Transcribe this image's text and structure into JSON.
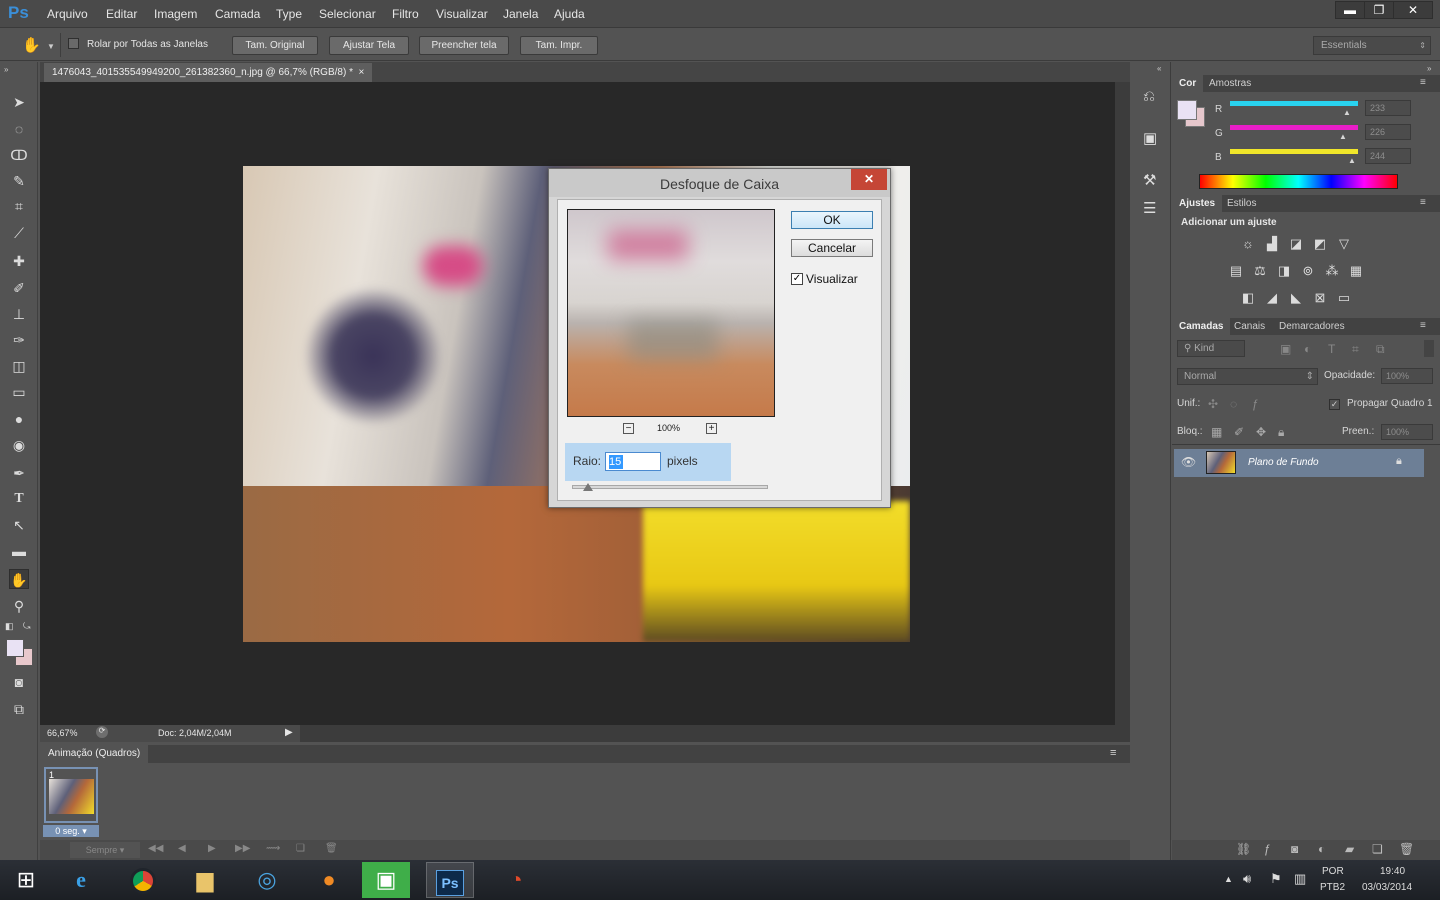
{
  "app": {
    "logo": "Ps"
  },
  "menu": [
    "Arquivo",
    "Editar",
    "Imagem",
    "Camada",
    "Type",
    "Selecionar",
    "Filtro",
    "Visualizar",
    "Janela",
    "Ajuda"
  ],
  "window_controls": {
    "minimize": "▬",
    "restore": "❐",
    "close": "✕"
  },
  "options": {
    "checkbox_label": "Rolar por Todas as Janelas",
    "buttons": [
      "Tam. Original",
      "Ajustar Tela",
      "Preencher tela",
      "Tam. Impr."
    ],
    "workspace": "Essentials"
  },
  "document": {
    "tab_title": "1476043_401535549949200_261382360_n.jpg @ 66,7% (RGB/8) *",
    "tab_close": "×"
  },
  "status": {
    "zoom": "66,67%",
    "doc": "Doc: 2,04M/2,04M"
  },
  "dialog": {
    "title": "Desfoque de Caixa",
    "close": "✕",
    "ok": "OK",
    "cancel": "Cancelar",
    "preview_label": "Visualizar",
    "preview_checked": true,
    "zoom": "100%",
    "zoom_out": "−",
    "zoom_in": "+",
    "radius_label": "Raio:",
    "radius_value": "15",
    "radius_unit": "pixels"
  },
  "color_panel": {
    "tabs": [
      "Cor",
      "Amostras"
    ],
    "rows": [
      {
        "label": "R",
        "value": "233",
        "color": "#29d3f0"
      },
      {
        "label": "G",
        "value": "226",
        "color": "#e81ec8"
      },
      {
        "label": "B",
        "value": "244",
        "color": "#f0e62a"
      }
    ],
    "foreground": "#e9e2f4"
  },
  "adjust_panel": {
    "tabs": [
      "Ajustes",
      "Estilos"
    ],
    "heading": "Adicionar um ajuste"
  },
  "layers_panel": {
    "tabs": [
      "Camadas",
      "Canais",
      "Demarcadores"
    ],
    "kind": "Kind",
    "blend": "Normal",
    "opacity_label": "Opacidade:",
    "opacity": "100%",
    "unify_label": "Unif.:",
    "propagate": "Propagar Quadro 1",
    "lock_label": "Bloq.:",
    "fill_label": "Preen.:",
    "fill": "100%",
    "layer_name": "Plano de Fundo"
  },
  "animation": {
    "title": "Animação (Quadros)",
    "frame_number": "1",
    "frame_delay": "0 seg.",
    "loop": "Sempre"
  },
  "taskbar": {
    "lang": "POR",
    "layout": "PTB2",
    "time": "19:40",
    "date": "03/03/2014"
  }
}
